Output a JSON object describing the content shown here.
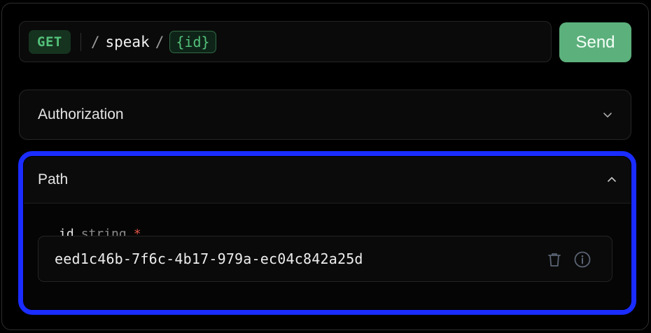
{
  "request": {
    "method": "GET",
    "path_segments": [
      "speak"
    ],
    "path_param": "{id}"
  },
  "send_label": "Send",
  "sections": {
    "authorization": {
      "title": "Authorization",
      "expanded": false
    },
    "path": {
      "title": "Path",
      "expanded": true
    }
  },
  "path_fields": [
    {
      "name": "id",
      "type": "string",
      "required_marker": "*",
      "value": "eed1c46b-7f6c-4b17-979a-ec04c842a25d"
    }
  ],
  "icons": {
    "authorization_toggle": "chevron-down-icon",
    "path_toggle": "chevron-up-icon",
    "clear": "trash-icon",
    "info": "info-icon"
  },
  "colors": {
    "accent_green": "#53c17a",
    "send_button": "#5cb07c",
    "highlight": "#1a2cff",
    "required": "#e05545"
  }
}
